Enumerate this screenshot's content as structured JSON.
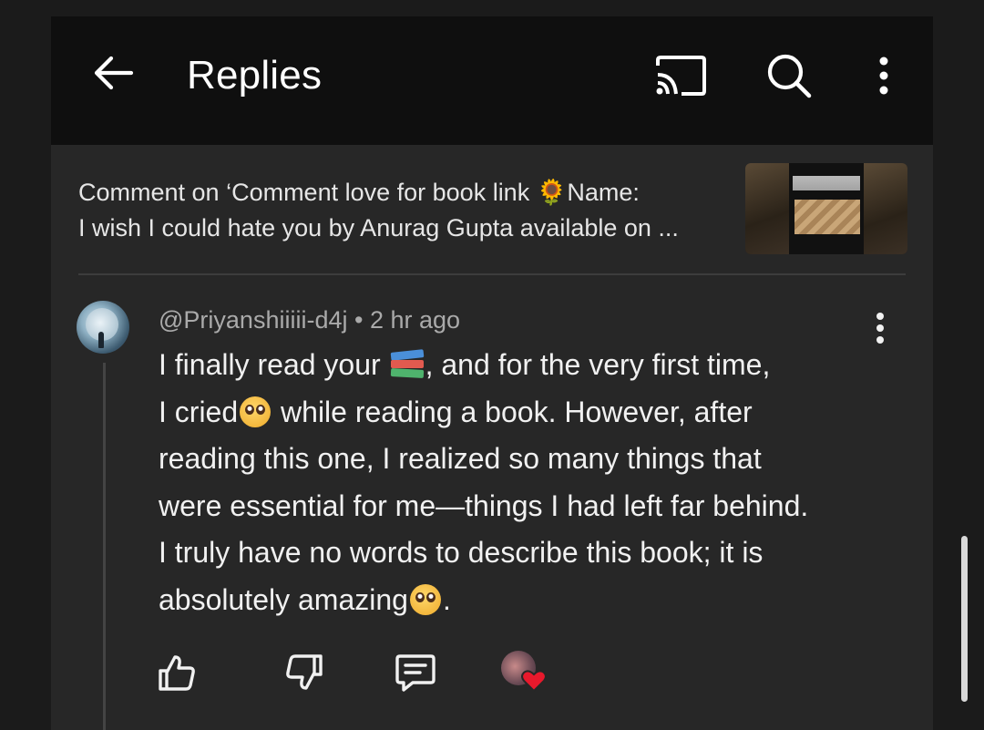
{
  "appbar": {
    "title": "Replies",
    "icons": [
      "back-arrow-icon",
      "cast-icon",
      "search-icon",
      "more-vert-icon"
    ]
  },
  "context": {
    "line1_pre": "Comment on ‘Comment love for book link ",
    "line1_emoji": "🌻",
    "line1_post": "Name:",
    "line2": "I wish I could hate you by Anurag Gupta available on ..."
  },
  "reply": {
    "handle": "@Priyanshiiiii-d4j",
    "separator": " • ",
    "time": "2 hr ago",
    "body": {
      "l1_pre": "I finally read your ",
      "l1_post": ", and for the very first time,",
      "l2_pre": "I cried",
      "l2_post": " while reading a book. However, after",
      "l3": "reading this one, I realized so many things that",
      "l4": "were essential for me—things I had left far behind.",
      "l5": "I truly have no words to describe this book; it is",
      "l6_pre": "absolutely amazing",
      "l6_post": "."
    },
    "emojis": [
      "books-emoji",
      "pleading-face-emoji",
      "pleading-face-emoji"
    ],
    "actions": [
      "thumbs-up-icon",
      "thumbs-down-icon",
      "reply-icon",
      "creator-heart-icon"
    ]
  },
  "colors": {
    "background": "#272727",
    "appbar": "#0f0f0f",
    "text": "#f1f1f1",
    "meta": "#aaaaaa",
    "heart": "#e8192c"
  }
}
